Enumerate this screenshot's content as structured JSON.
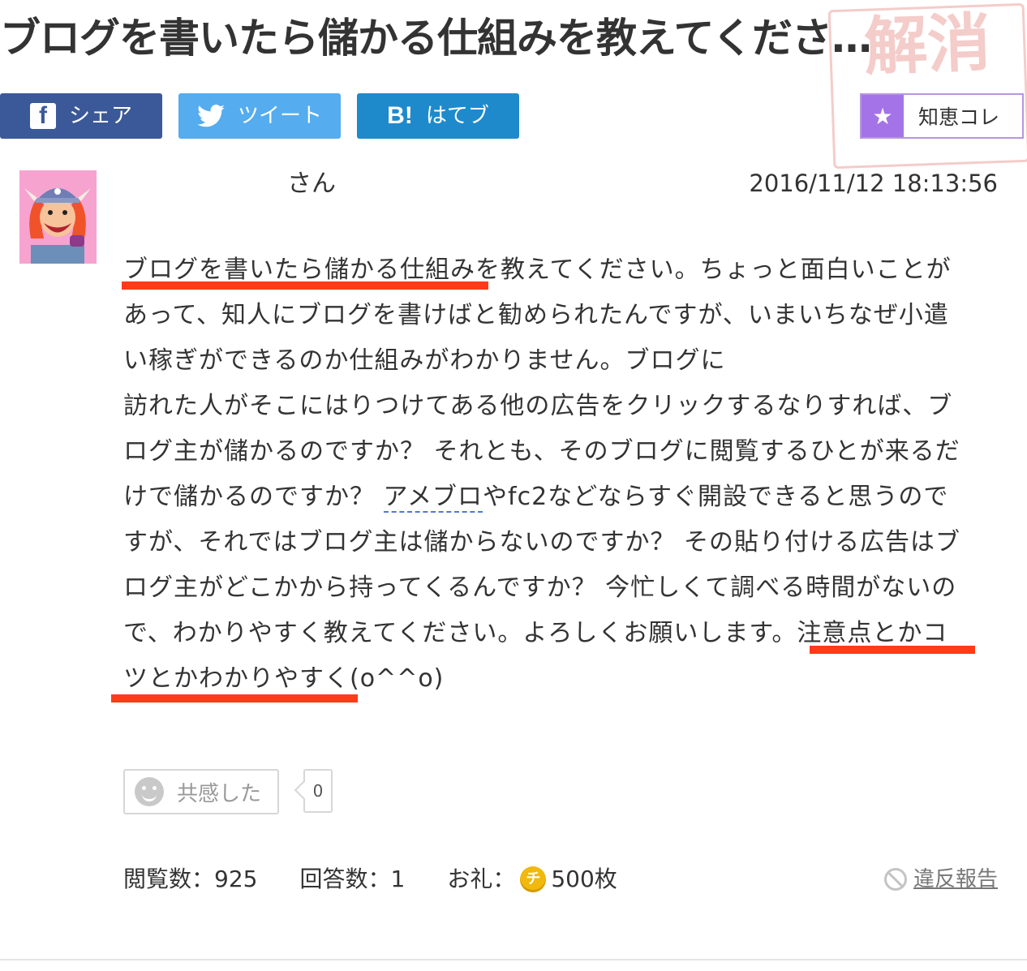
{
  "question": {
    "title": "ブログを書いたら儲かる仕組みを教えてくださ…",
    "author_suffix": "さん",
    "posted_at": "2016/11/12  18:13:56",
    "body_lines": [
      "ブログを書いたら儲かる仕組みを教えてください。ちょっと面白いことが",
      "あって、知人にブログを書けばと勧められたんですが、いまいちなぜ小遣",
      "い稼ぎができるのか仕組みがわかりません。ブログに",
      "訪れた人がそこにはりつけてある他の広告をクリックするなりすれば、ブ",
      "ログ主が儲かるのですか？ それとも、そのブログに閲覧するひとが来るだ",
      "けで儲かるのですか？ ",
      "アメブロ",
      "やfc2などならすぐ開設できると思うので",
      "すが、それではブログ主は儲からないのですか？ その貼り付ける広告はブ",
      "ログ主がどこかから持ってくるんですか？ 今忙しくて調べる時間がないの",
      "で、わかりやすく教えてください。よろしくお願いします。注意点とかコ",
      "ツとかわかりやすく(o^^o)"
    ]
  },
  "share": {
    "facebook_icon": "f",
    "facebook_label": "シェア",
    "twitter_label": "ツイート",
    "hatena_icon": "B!",
    "hatena_label": "はてブ",
    "chiekore_label": "知恵コレ"
  },
  "stamp_text": "解消",
  "empathy": {
    "label": "共感した",
    "count": "0"
  },
  "stats": {
    "views_label": "閲覧数：",
    "views": "925",
    "answers_label": "回答数：",
    "answers": "1",
    "reward_label": "お礼：",
    "coin_symbol": "チ",
    "reward": "500枚"
  },
  "report_label": "違反報告",
  "colors": {
    "facebook": "#3b5998",
    "twitter": "#55acee",
    "hatena": "#1f8acb",
    "chiekore_star": "#a473e8",
    "highlight_underline": "#ff3b1a"
  }
}
